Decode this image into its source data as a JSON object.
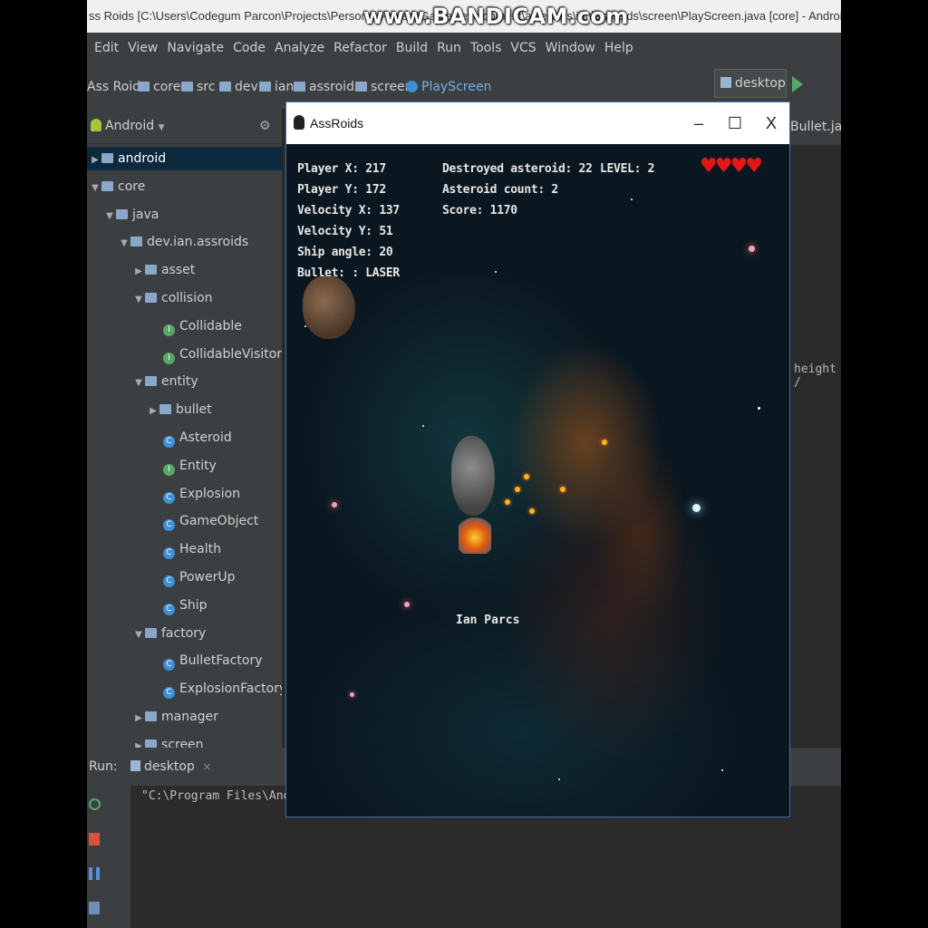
{
  "ide": {
    "title": "ss Roids [C:\\Users\\Codegum Parcon\\Projects\\Personal Project\\GameDevelopment\\asteroids\\ian\\assroids\\screen\\PlayScreen.java [core] - Android Studio",
    "watermark": "www.BANDICAM.com",
    "menu": [
      "Edit",
      "View",
      "Navigate",
      "Code",
      "Analyze",
      "Refactor",
      "Build",
      "Run",
      "Tools",
      "VCS",
      "Window",
      "Help"
    ],
    "breadcrumbs": [
      "Ass Roids",
      "core",
      "src",
      "dev",
      "ian",
      "assroids",
      "screen",
      "PlayScreen"
    ],
    "run_config": "desktop",
    "project_view": "Android",
    "tree": [
      {
        "label": "android",
        "type": "module",
        "expanded": false,
        "selected": true
      },
      {
        "label": "core",
        "type": "module",
        "expanded": true
      },
      {
        "label": "java",
        "type": "folder",
        "expanded": true
      },
      {
        "label": "dev.ian.assroids",
        "type": "folder",
        "expanded": true
      },
      {
        "label": "asset",
        "type": "folder",
        "expanded": false
      },
      {
        "label": "collision",
        "type": "folder",
        "expanded": true
      },
      {
        "label": "Collidable",
        "type": "interface"
      },
      {
        "label": "CollidableVisitor",
        "type": "interface"
      },
      {
        "label": "entity",
        "type": "folder",
        "expanded": true
      },
      {
        "label": "bullet",
        "type": "folder",
        "expanded": false
      },
      {
        "label": "Asteroid",
        "type": "class"
      },
      {
        "label": "Entity",
        "type": "interface"
      },
      {
        "label": "Explosion",
        "type": "class"
      },
      {
        "label": "GameObject",
        "type": "class"
      },
      {
        "label": "Health",
        "type": "class"
      },
      {
        "label": "PowerUp",
        "type": "class"
      },
      {
        "label": "Ship",
        "type": "class"
      },
      {
        "label": "factory",
        "type": "folder",
        "expanded": true
      },
      {
        "label": "BulletFactory",
        "type": "class"
      },
      {
        "label": "ExplosionFactory",
        "type": "class"
      },
      {
        "label": "manager",
        "type": "folder",
        "expanded": false
      },
      {
        "label": "screen",
        "type": "folder",
        "expanded": false
      }
    ],
    "editor_tab": "Bullet.java",
    "code_fragment": "height /",
    "run": {
      "label": "Run:",
      "tab": "desktop",
      "console": "\"C:\\Program Files\\Android\\"
    }
  },
  "game_window": {
    "title": "AssRoids",
    "buttons": {
      "minimize": "–",
      "maximize": "☐",
      "close": "X"
    },
    "hud": {
      "player_x": "Player X: 217",
      "player_y": "Player Y: 172",
      "velocity_x": "Velocity X: 137",
      "velocity_y": "Velocity Y: 51",
      "ship_angle": "Ship angle: 20",
      "bullet": "Bullet: : LASER",
      "destroyed": "Destroyed asteroid: 22",
      "asteroid_count": "Asteroid count: 2",
      "score": "Score: 1170",
      "level": "LEVEL: 2"
    },
    "lives": 4,
    "player_name": "Ian Parcs",
    "colors": {
      "heart": "#e01818",
      "bullet": "#ffb020",
      "accent": "#3d8fd6"
    }
  }
}
